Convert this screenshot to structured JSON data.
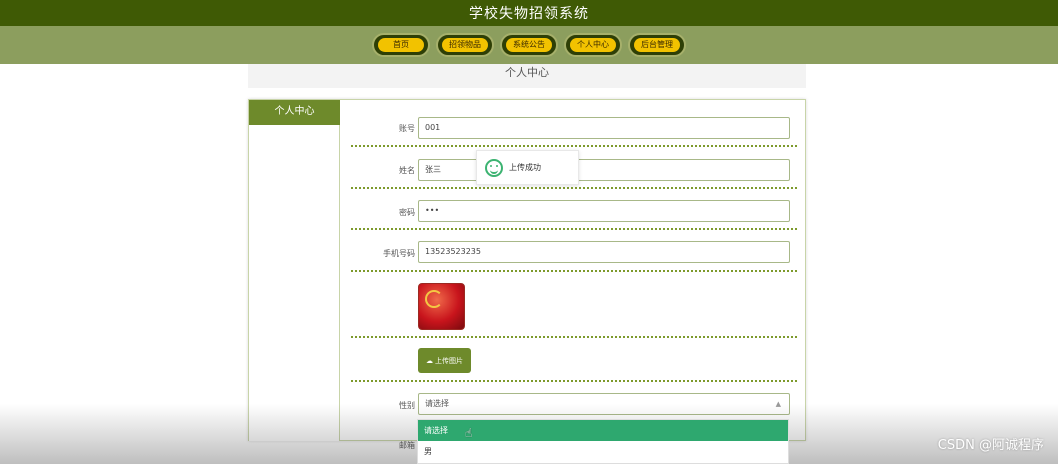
{
  "app": {
    "title": "学校失物招领系统"
  },
  "nav": [
    {
      "label": "首页"
    },
    {
      "label": "招领物品"
    },
    {
      "label": "系统公告"
    },
    {
      "label": "个人中心"
    },
    {
      "label": "后台管理"
    }
  ],
  "page": {
    "heading": "个人中心"
  },
  "sidebar": {
    "title": "个人中心"
  },
  "form": {
    "account": {
      "label": "账号",
      "value": "001"
    },
    "name": {
      "label": "姓名",
      "value": "张三"
    },
    "password": {
      "label": "密码",
      "value": "•••"
    },
    "phone": {
      "label": "手机号码",
      "value": "13523523235"
    },
    "upload": {
      "label": "上传图片",
      "icon": "cloud-upload-icon"
    },
    "gender": {
      "label": "性别",
      "placeholder": "请选择",
      "options": [
        "请选择",
        "男"
      ]
    },
    "email": {
      "label": "邮箱"
    }
  },
  "toast": {
    "message": "上传成功",
    "icon": "smile-icon"
  },
  "watermark": "CSDN @阿诚程序",
  "colors": {
    "header": "#3f5a05",
    "nav": "#8c9e5e",
    "accent": "#6e8a2b",
    "button": "#f2c200",
    "selected": "#2ea86f"
  }
}
